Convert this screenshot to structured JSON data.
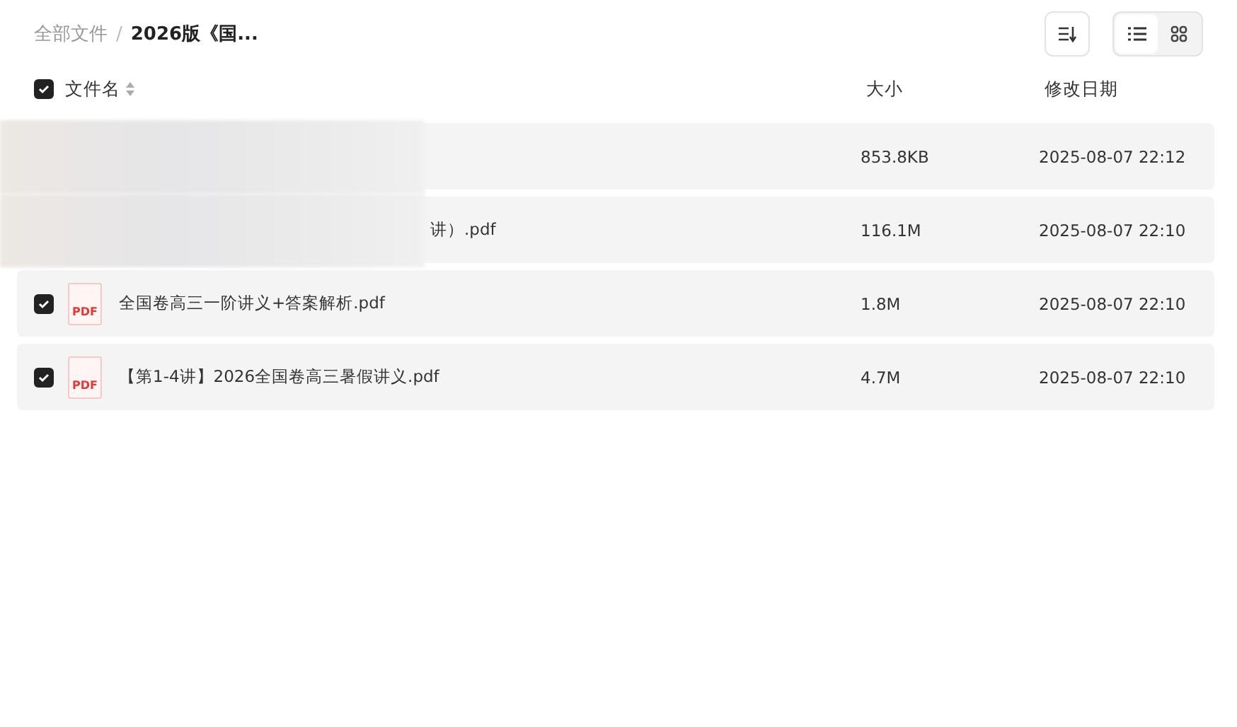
{
  "breadcrumb": [
    {
      "label": "全部文件",
      "current": false
    },
    {
      "label": "2026版《国...",
      "current": true
    }
  ],
  "separator": "/",
  "header": {
    "checked": true,
    "name": "文件名",
    "size": "大小",
    "date": "修改日期"
  },
  "views": [
    {
      "kind": "list",
      "selected": true
    },
    {
      "kind": "grid",
      "selected": false
    }
  ],
  "rows": [
    {
      "obscured": true,
      "size": "853.8KB",
      "date": "2025-08-07 22:12"
    },
    {
      "obscured": true,
      "name": "讲）.pdf",
      "size": "116.1M",
      "date": "2025-08-07 22:10"
    },
    {
      "obscured": false,
      "checked": true,
      "icon": "PDF",
      "name": "全国卷高三一阶讲义+答案解析.pdf",
      "size": "1.8M",
      "date": "2025-08-07 22:10"
    },
    {
      "obscured": false,
      "checked": true,
      "icon": "PDF",
      "name": "【第1-4讲】2026全国卷高三暑假讲义.pdf",
      "size": "4.7M",
      "date": "2025-08-07 22:10"
    }
  ]
}
